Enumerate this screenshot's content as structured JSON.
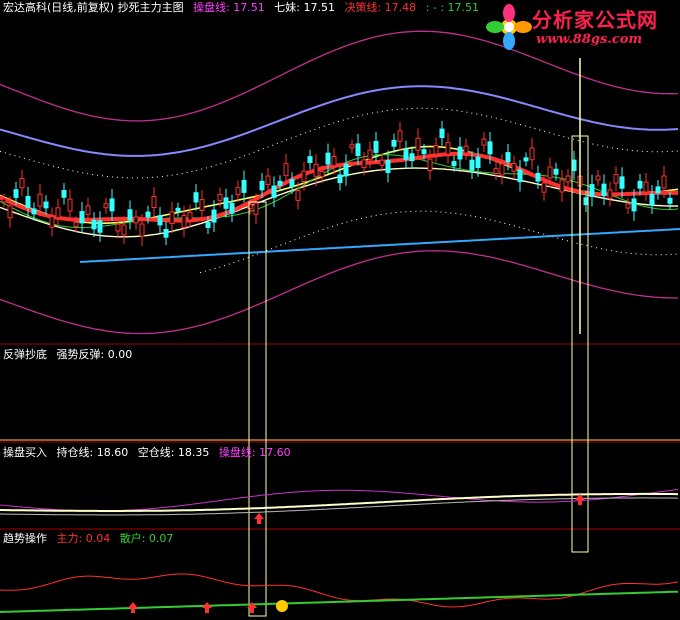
{
  "main_panel": {
    "title": "宏达高科(日线,前复权) 抄死主力主图",
    "items": [
      {
        "label": "操盘线: 17.51",
        "color": "#ff40ff"
      },
      {
        "label": "七妹: 17.51",
        "color": "#ffffff"
      },
      {
        "label": "决策线: 17.48",
        "color": "#ff3030"
      },
      {
        "label": ": - : 17.51",
        "color": "#33cc33"
      }
    ]
  },
  "panel2": {
    "title": "反弹抄底",
    "items": [
      {
        "label": "强势反弹: 0.00",
        "color": "#ffffff"
      }
    ]
  },
  "panel3": {
    "title": "操盘买入",
    "items": [
      {
        "label": "持仓线: 18.60",
        "color": "#ffffff"
      },
      {
        "label": "空仓线: 18.35",
        "color": "#ffffff"
      },
      {
        "label": "操盘线: 17.60",
        "color": "#ff40ff"
      }
    ]
  },
  "panel4": {
    "title": "趋势操作",
    "items": [
      {
        "label": "主力: 0.04",
        "color": "#ff3030"
      },
      {
        "label": "散户: 0.07",
        "color": "#33cc33"
      }
    ]
  },
  "watermark": {
    "cn": "分析家公式网",
    "url": "www.88gs.com"
  },
  "colors": {
    "up": "#ff3030",
    "down": "#33ffff",
    "bg": "#000000",
    "divider": "#aa0000"
  },
  "chart_data": {
    "type": "line",
    "series": [
      {
        "name": "操盘线",
        "color": "#ff40ff"
      },
      {
        "name": "七妹",
        "color": "#ffffff"
      },
      {
        "name": "决策线",
        "color": "#ff3030"
      },
      {
        "name": "持仓线",
        "color": "#ffffff"
      },
      {
        "name": "空仓线",
        "color": "#ffffff"
      },
      {
        "name": "主力",
        "color": "#ff3030"
      },
      {
        "name": "散户",
        "color": "#33cc33"
      }
    ]
  }
}
